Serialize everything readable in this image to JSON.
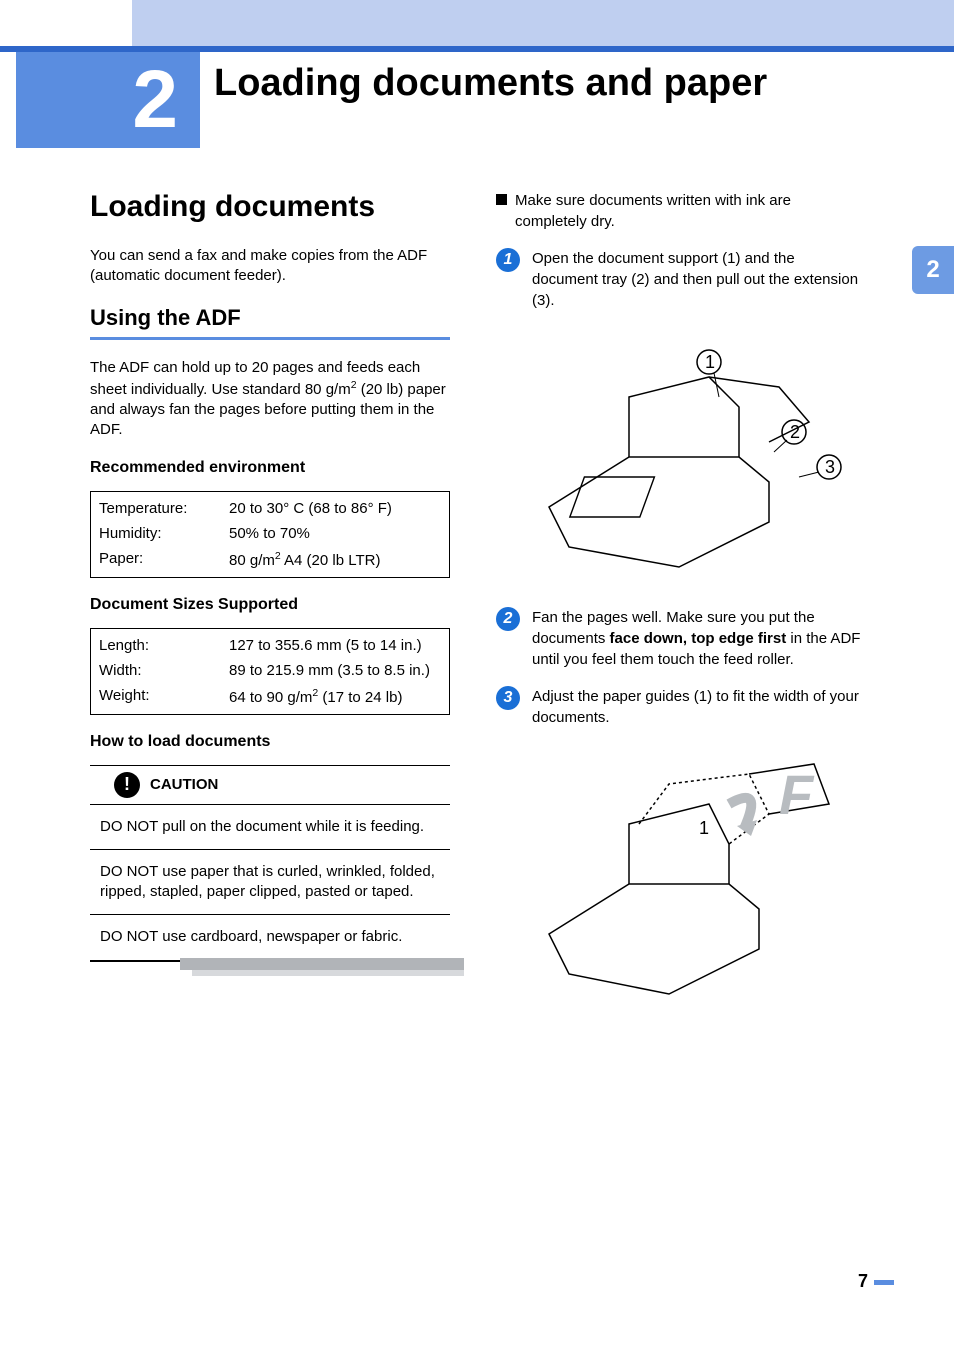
{
  "chapter": {
    "number": "2",
    "title": "Loading documents and paper"
  },
  "sideTab": "2",
  "pageNumber": "7",
  "left": {
    "h1": "Loading documents",
    "intro": "You can send a fax and make copies from the ADF (automatic document feeder).",
    "h2": "Using the ADF",
    "adf_text_a": "The ADF can hold up to 20 pages and feeds each sheet individually. Use standard 80 g/m",
    "adf_text_b": " (20 lb) paper and always fan the pages before putting them in the ADF.",
    "env_h3": "Recommended environment",
    "env": [
      {
        "label": "Temperature:",
        "value": "20 to 30° C (68 to 86° F)"
      },
      {
        "label": "Humidity:",
        "value": "50% to 70%"
      },
      {
        "label": "Paper:",
        "value_a": "80 g/m",
        "value_b": " A4 (20 lb LTR)"
      }
    ],
    "sizes_h3": "Document Sizes Supported",
    "sizes": [
      {
        "label": "Length:",
        "value": "127 to 355.6 mm (5 to 14 in.)"
      },
      {
        "label": "Width:",
        "value": "89 to 215.9 mm (3.5 to 8.5 in.)"
      },
      {
        "label": "Weight:",
        "value_a": "64 to 90 g/m",
        "value_b": " (17 to 24 lb)"
      }
    ],
    "how_h3": "How to load documents",
    "caution_label": "CAUTION",
    "caution": [
      "DO NOT pull on the document while it is feeding.",
      "DO NOT use paper that is curled, wrinkled, folded, ripped, stapled, paper clipped, pasted or taped.",
      "DO NOT use cardboard, newspaper or fabric."
    ]
  },
  "right": {
    "bullet": "Make sure documents written with ink are completely dry.",
    "steps": [
      {
        "n": "1",
        "text": "Open the document support (1) and the document tray (2) and then pull out the extension (3)."
      },
      {
        "n": "2",
        "text_a": "Fan the pages well. Make sure you put the documents ",
        "bold": "face down, top edge first",
        "text_b": " in the ADF until you feel them touch the feed roller."
      },
      {
        "n": "3",
        "text": "Adjust the paper guides (1) to fit the width of your documents."
      }
    ],
    "diagram1_callouts": [
      "1",
      "2",
      "3"
    ],
    "diagram2_callout": "1"
  }
}
